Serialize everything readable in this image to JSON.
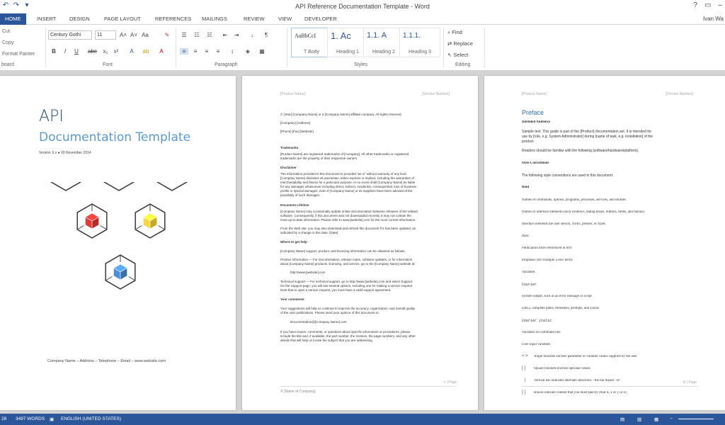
{
  "window": {
    "title": "API Reference Documentation Template - Word",
    "help": "?",
    "user": "Ivan Wa"
  },
  "qat": {
    "undo": "↶",
    "redo": "↷",
    "customize": "▾"
  },
  "tabs": [
    "HOME",
    "INSERT",
    "DESIGN",
    "PAGE LAYOUT",
    "REFERENCES",
    "MAILINGS",
    "REVIEW",
    "VIEW",
    "DEVELOPER"
  ],
  "ribbon": {
    "clipboard": {
      "cut": "Cut",
      "copy": "Copy",
      "format_painter": "Format Painter",
      "label": "board"
    },
    "font": {
      "name": "Century Gothi",
      "size": "11",
      "label": "Font"
    },
    "paragraph": {
      "label": "Paragraph"
    },
    "styles": {
      "label": "Styles",
      "items": [
        {
          "preview": "AaBbCcI",
          "name": "T Body"
        },
        {
          "preview": "1. Ac",
          "name": "Heading 1"
        },
        {
          "preview": "1.1. A",
          "name": "Heading 2"
        },
        {
          "preview": "1.1.1.",
          "name": "Heading 3"
        }
      ]
    },
    "editing": {
      "find": "Find",
      "replace": "Replace",
      "select": "Select",
      "label": "Editing"
    }
  },
  "page1": {
    "title": "API",
    "subtitle": "Documentation Template",
    "version": "Version X.x ● 00 November 2014",
    "footer": "Company Name – Address – Telephone – Email – www.website.com",
    "cube_colors": [
      "#7cb342",
      "#c62828",
      "#1565c0",
      "#e53935",
      "#fdd835",
      "#4a90d9"
    ]
  },
  "page2": {
    "header_left": "[Product Name]",
    "header_right": "[Version Number]",
    "lines": [
      "© [Year] [Company Name] or a [Company Name] affiliate company. All rights reserved.",
      "[Company] [Address]",
      "[Phone] [Fax] [Website]",
      "Trademarks",
      "[Product Name] are registered trademarks of [Company]. All other trademarks or registered",
      "trademarks are the property of their respective owners.",
      "Disclaimer",
      "The information provided in this document is provided \"as is\" without warranty of any kind.",
      "[Company Name] disclaims all warranties, either express or implied, including the warranties of",
      "merchantability and fitness for a particular purpose. In no event shall [Company Name] be liable",
      "for any damages whatsoever including direct, indirect, incidental, consequential, loss of business",
      "profits or special damages, even if [Company Name] or its suppliers have been advised of the",
      "possibility of such damages.",
      "Document Lifetime",
      "[Company Name] may occasionally update online documentation between releases of the related",
      "software. Consequently, if this document was not downloaded recently, it may not contain the",
      "most up-to-date information. Please refer to www.[website].com for the most current information.",
      "From the Web site, you may also download and refresh this document if it has been updated, as",
      "indicated by a change in this date: [Date].",
      "Where to get help",
      "[Company Name] support, product, and licensing information can be obtained as follows.",
      "Product information — For documentation, release notes, software updates, or for information",
      "about [Company Name] products, licensing, and service, go to the [Company Name] website at:",
      "http://www.[website].com",
      "Technical support — For technical support, go to http://www.[website].com and select Support.",
      "On the Support page, you will see several options, including one for making a service request.",
      "Note that to open a service request, you must have a valid support agreement.",
      "Your comments",
      "Your suggestions will help us continue to improve the accuracy, organization, and overall quality",
      "of the user publications. Please send your opinion of this document to:",
      "Documentation@[Company Name].com",
      "If you have issues, comments, or questions about specific information or procedures, please",
      "include the title and, if available, the part number, the revision, the page numbers, and any other",
      "details that will help us locate the subject that you are addressing."
    ],
    "footer": "© [Name of Company]",
    "page_number": "ii | Page"
  },
  "page3": {
    "header_left": "[Product Name]",
    "header_right": "[Version Number]",
    "heading": "Preface",
    "lines": [
      "Intended Audience",
      "Sample text: This guide is part of the [Product] documentation set. It is intended for",
      "use by [role, e.g. System Administrator] during [name of task, e.g. installation] of the",
      "product.",
      "Readers should be familiar with the following [software/hardware/platform].",
      "Style Conventions",
      "The following style conventions are used in this document:",
      "Bold",
      "Names of commands, options, programs, processes, services, and utilities",
      "Names of interface elements (such windows, dialog boxes, buttons, fields, and menus)",
      "Interface elements the user selects, clicks, presses, or types",
      "Italic",
      "Publication titles referenced in text",
      "Emphasis (for example a new term)",
      "Variables",
      "Courier",
      "System output, such as an error message or script",
      "URLs, complete paths, filenames, prompts, and syntax",
      "Courier italic",
      "Variables on command line",
      "User input variables",
      "Angle brackets enclose parameter or variable values supplied by the user",
      "Square brackets enclose optional values",
      "Vertical bar indicates alternate selections - the bar means \"or\"",
      "Braces indicate content that you must specify (that is, x or y or z)"
    ],
    "markers": [
      "< >",
      "[ ]",
      "|",
      "{ }"
    ],
    "page_number": "iii | Page"
  },
  "statusbar": {
    "page": "28",
    "words": "3497 WORDS",
    "language": "ENGLISH (UNITED STATES)"
  },
  "colors": {
    "accent": "#2b579a",
    "title_dark": "#1f4e79",
    "title_light": "#5b9bd5"
  }
}
